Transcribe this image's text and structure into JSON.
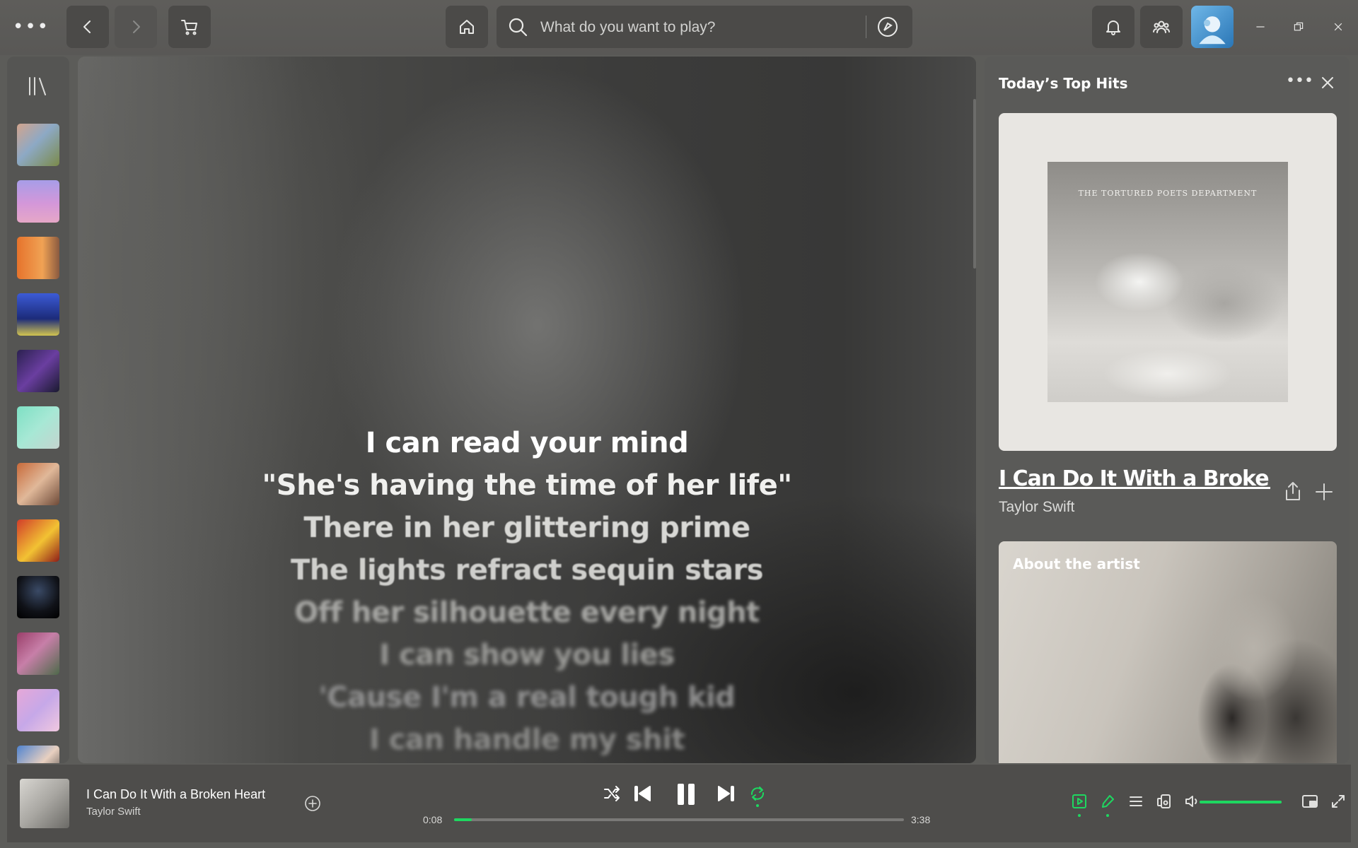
{
  "topbar": {
    "search_placeholder": "What do you want to play?"
  },
  "lyrics": [
    {
      "text": "I can read your mind",
      "state": "current"
    },
    {
      "text": "\"She's having the time of her life\"",
      "state": "next"
    },
    {
      "text": "There in her glittering prime",
      "state": "upcoming"
    },
    {
      "text": "The lights refract sequin stars",
      "state": "upcoming"
    },
    {
      "text": "Off her silhouette every night",
      "state": "faded"
    },
    {
      "text": "I can show you lies",
      "state": "faded"
    },
    {
      "text": "'Cause I'm a real tough kid",
      "state": "faded"
    },
    {
      "text": "I can handle my shit",
      "state": "faded"
    }
  ],
  "right_panel": {
    "title": "Today’s Top Hits",
    "album_art_text": "THE TORTURED POETS DEPARTMENT",
    "song_title": "I Can Do It With a Broken Heart",
    "artist": "Taylor Swift",
    "about_title": "About the artist"
  },
  "player": {
    "title": "I Can Do It With a Broken Heart",
    "artist": "Taylor Swift",
    "elapsed": "0:08",
    "total": "3:38",
    "progress_fraction": 0.04,
    "volume_fraction": 1.0
  },
  "colors": {
    "accent": "#1ed760",
    "background": "#5c5c59"
  }
}
